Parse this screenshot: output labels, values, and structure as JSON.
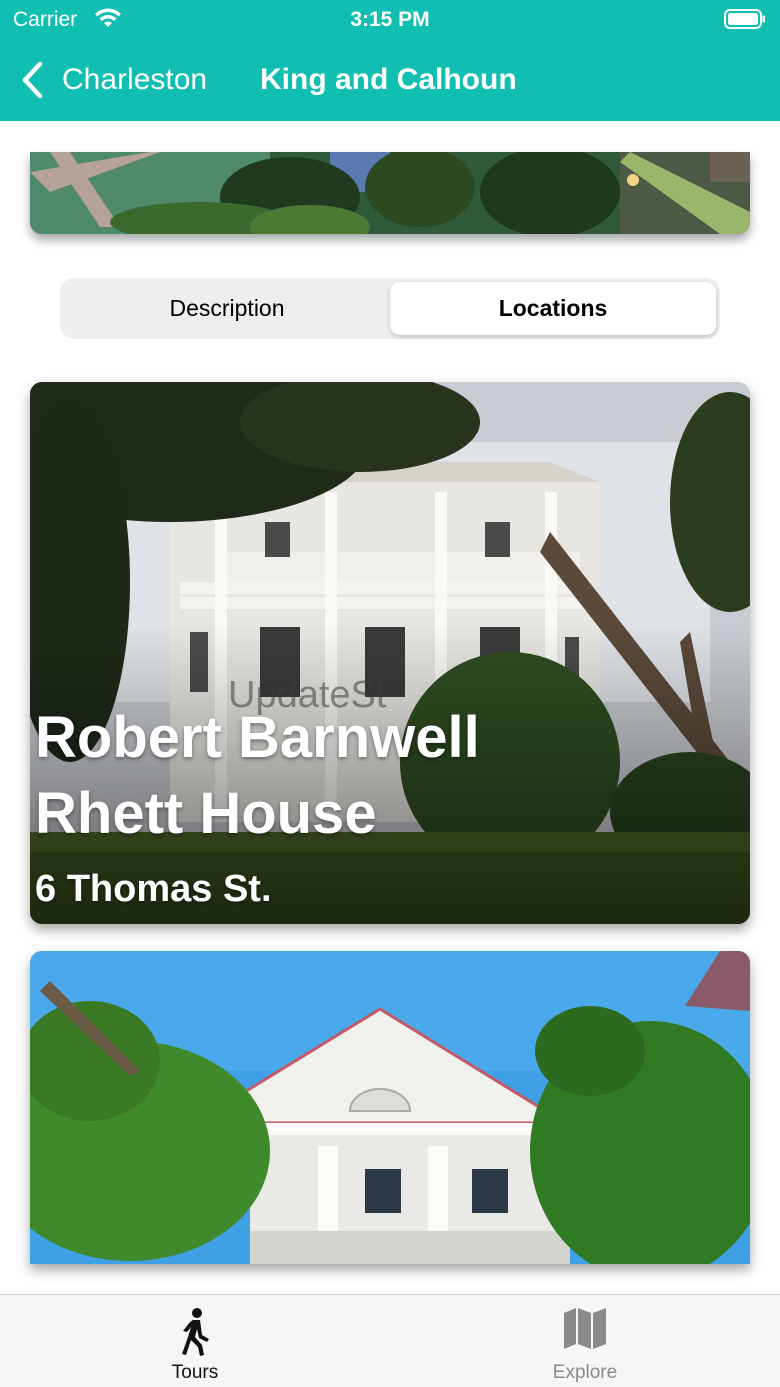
{
  "status_bar": {
    "carrier": "Carrier",
    "time": "3:15 PM"
  },
  "nav": {
    "back_label": "Charleston",
    "title": "King and Calhoun"
  },
  "segmented": {
    "options": [
      "Description",
      "Locations"
    ],
    "selected": "Locations"
  },
  "locations": [
    {
      "name": "Robert Barnwell Rhett House",
      "address": "6 Thomas St.",
      "watermark": "UpdateSt"
    },
    {
      "name": "",
      "address": ""
    }
  ],
  "tab_bar": {
    "tabs": [
      {
        "label": "Tours",
        "icon": "walking-person-icon",
        "active": true
      },
      {
        "label": "Explore",
        "icon": "map-icon",
        "active": false
      }
    ]
  },
  "colors": {
    "accent": "#10bfb1",
    "tab_active": "#111111",
    "tab_inactive": "#8a8a8a"
  }
}
